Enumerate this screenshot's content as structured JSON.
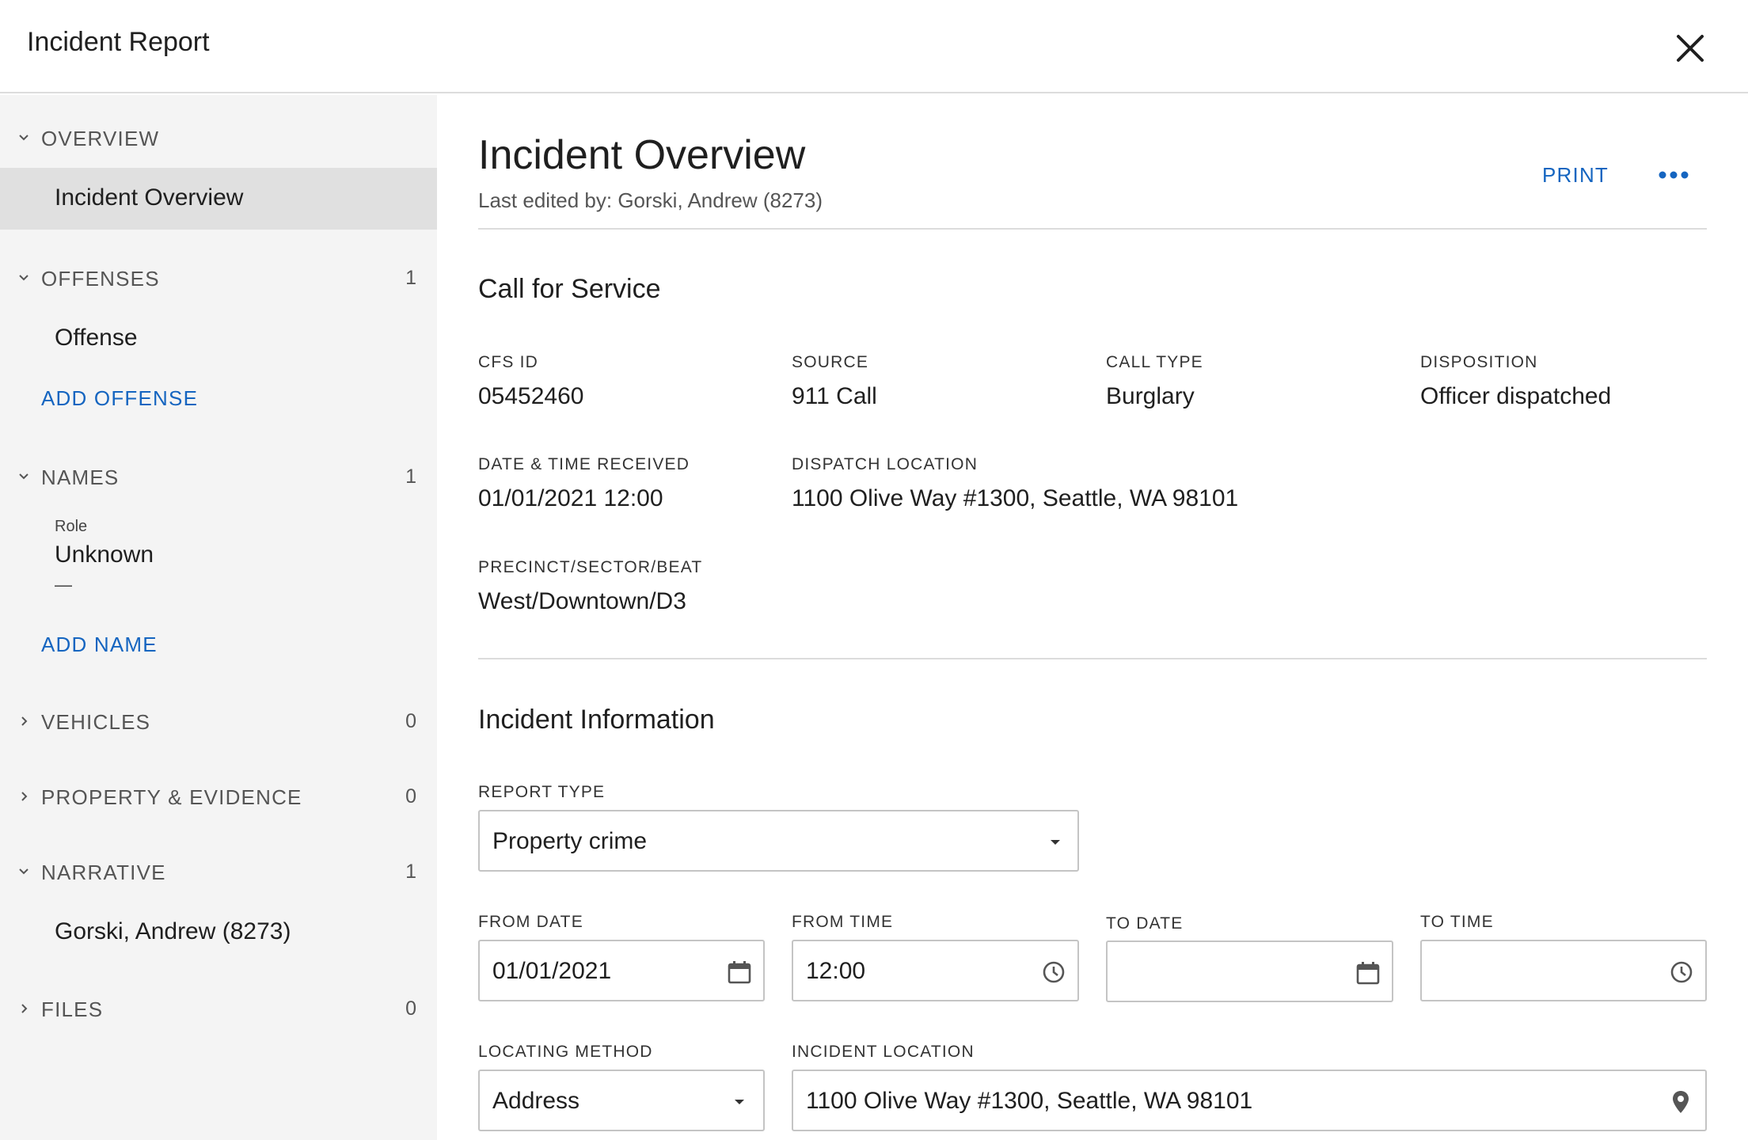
{
  "header": {
    "title": "Incident Report",
    "close_icon": "close-icon"
  },
  "sidebar": {
    "sections": [
      {
        "label": "OVERVIEW",
        "count": "",
        "expanded": true
      },
      {
        "label": "OFFENSES",
        "count": "1",
        "expanded": true
      },
      {
        "label": "NAMES",
        "count": "1",
        "expanded": true
      },
      {
        "label": "VEHICLES",
        "count": "0",
        "expanded": false
      },
      {
        "label": "PROPERTY & EVIDENCE",
        "count": "0",
        "expanded": false
      },
      {
        "label": "NARRATIVE",
        "count": "1",
        "expanded": true
      },
      {
        "label": "FILES",
        "count": "0",
        "expanded": false
      }
    ],
    "items": {
      "overview": "Incident Overview",
      "offense": "Offense",
      "narrative": "Gorski, Andrew (8273)"
    },
    "add_offense": "ADD OFFENSE",
    "add_name": "ADD NAME",
    "name_entry": {
      "role_caption": "Role",
      "role_value": "Unknown",
      "detail": "—"
    }
  },
  "main": {
    "title": "Incident Overview",
    "last_edited": "Last edited by: Gorski, Andrew (8273)",
    "print_label": "PRINT",
    "call_for_service": {
      "title": "Call for Service",
      "fields": [
        {
          "label": "CFS ID",
          "value": "05452460"
        },
        {
          "label": "SOURCE",
          "value": "911 Call"
        },
        {
          "label": "CALL TYPE",
          "value": "Burglary"
        },
        {
          "label": "DISPOSITION",
          "value": "Officer dispatched"
        },
        {
          "label": "DATE & TIME RECEIVED",
          "value": "01/01/2021 12:00"
        },
        {
          "label": "DISPATCH LOCATION",
          "value": "1100 Olive Way #1300, Seattle, WA 98101"
        },
        {
          "label": "PRECINCT/SECTOR/BEAT",
          "value": "West/Downtown/D3"
        }
      ]
    },
    "incident_information": {
      "title": "Incident Information",
      "report_type": {
        "label": "REPORT TYPE",
        "value": "Property crime"
      },
      "from_date": {
        "label": "FROM DATE",
        "value": "01/01/2021"
      },
      "from_time": {
        "label": "FROM TIME",
        "value": "12:00"
      },
      "to_date": {
        "label": "TO DATE",
        "value": ""
      },
      "to_time": {
        "label": "TO TIME",
        "value": ""
      },
      "locating_method": {
        "label": "LOCATING METHOD",
        "value": "Address"
      },
      "incident_location": {
        "label": "INCIDENT LOCATION",
        "value": "1100 Olive Way #1300, Seattle, WA 98101"
      }
    }
  },
  "colors": {
    "accent": "#1565c0",
    "sidebar_bg": "#f4f4f4",
    "active_item_bg": "#e0e0e0",
    "divider": "#dcdcdc"
  }
}
